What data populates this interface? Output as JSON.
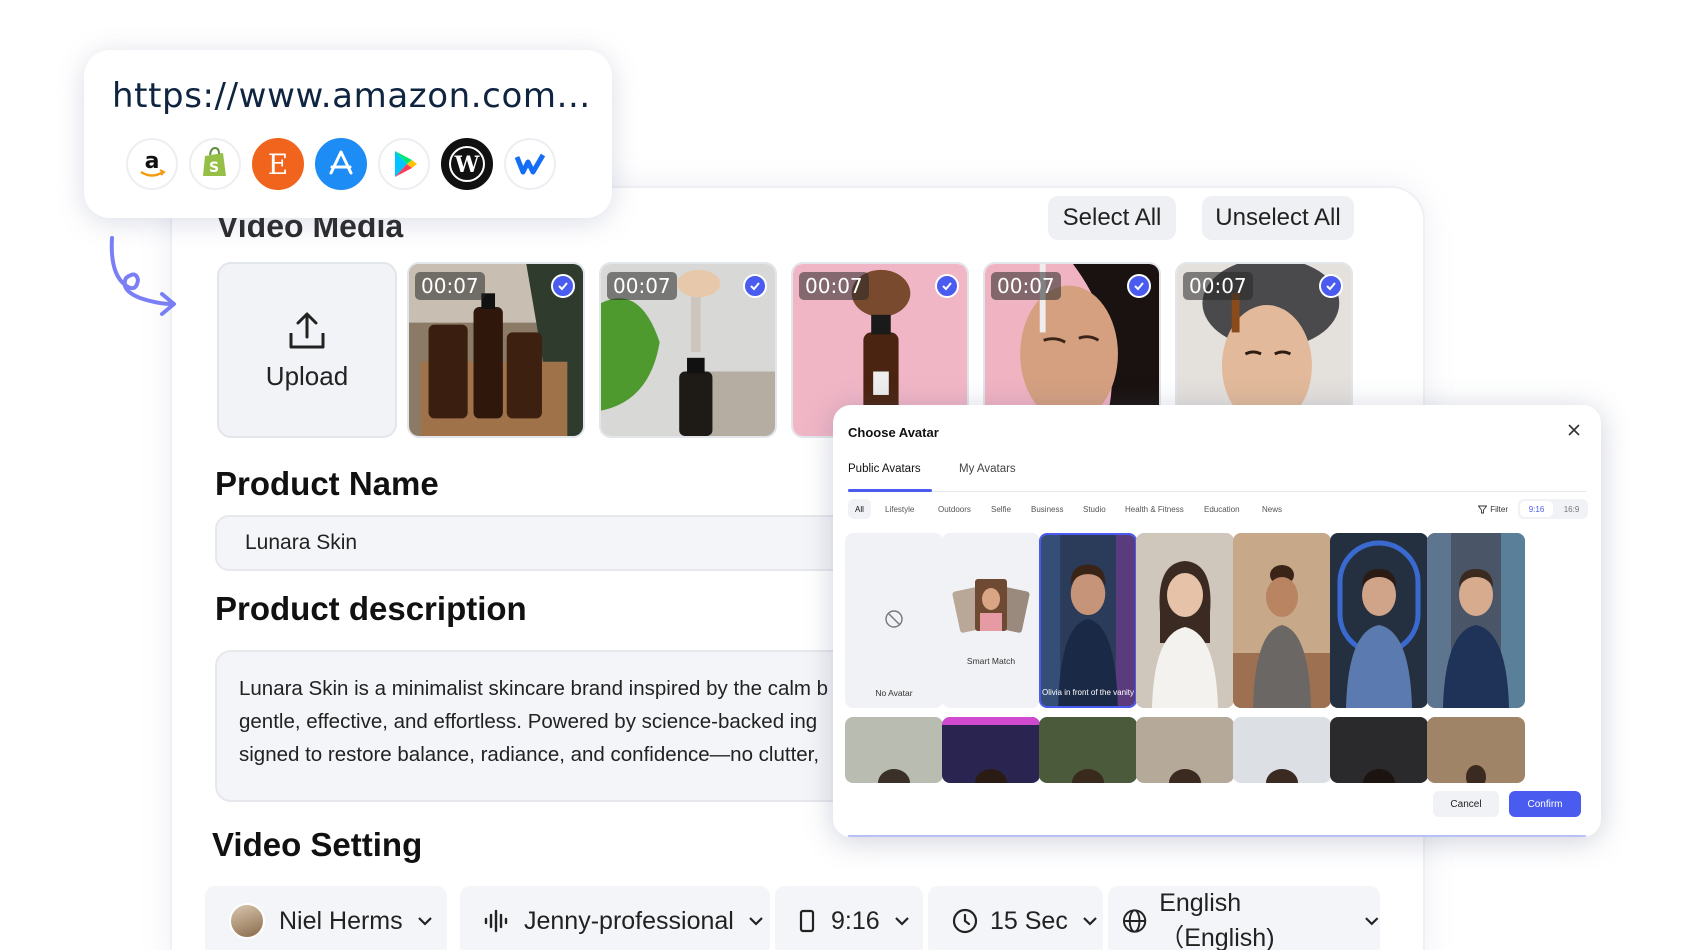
{
  "url_card": {
    "url": "https://www.amazon.com...",
    "logos": [
      "amazon-icon",
      "shopify-icon",
      "etsy-icon",
      "app-store-icon",
      "google-play-icon",
      "wordpress-icon",
      "webflow-icon"
    ]
  },
  "media": {
    "title": "Video Media",
    "select_all": "Select All",
    "unselect_all": "Unselect All",
    "upload_label": "Upload",
    "clips": [
      {
        "duration": "00:07",
        "selected": true
      },
      {
        "duration": "00:07",
        "selected": true
      },
      {
        "duration": "00:07",
        "selected": true
      },
      {
        "duration": "00:07",
        "selected": true
      },
      {
        "duration": "00:07",
        "selected": true
      }
    ]
  },
  "product": {
    "name_title": "Product Name",
    "name_value": "Lunara Skin",
    "desc_title": "Product description",
    "desc_lines": [
      "Lunara Skin is a minimalist skincare brand inspired by the calm b",
      "gentle, effective, and effortless. Powered by science-backed ing",
      "signed to restore balance, radiance, and confidence—no clutter,"
    ]
  },
  "settings": {
    "title": "Video Setting",
    "avatar": "Niel Herms",
    "voice": "Jenny-professional",
    "ratio": "9:16",
    "duration": "15 Sec",
    "language": "English（English)"
  },
  "modal": {
    "title": "Choose Avatar",
    "tabs": [
      "Public Avatars",
      "My Avatars"
    ],
    "filters": [
      "All",
      "Lifestyle",
      "Outdoors",
      "Selfie",
      "Business",
      "Studio",
      "Health & Fitness",
      "Education",
      "News"
    ],
    "filter_label": "Filter",
    "ratio_options": [
      "9:16",
      "16:9"
    ],
    "cells": {
      "no_avatar": "No Avatar",
      "smart_match": "Smart Match",
      "selected_caption": "Olivia in front of the vanity"
    },
    "cancel": "Cancel",
    "confirm": "Confirm"
  },
  "colors": {
    "accent": "#4a5cf0",
    "text_dark": "#0f2440",
    "panel_bg": "#f4f5f8"
  }
}
